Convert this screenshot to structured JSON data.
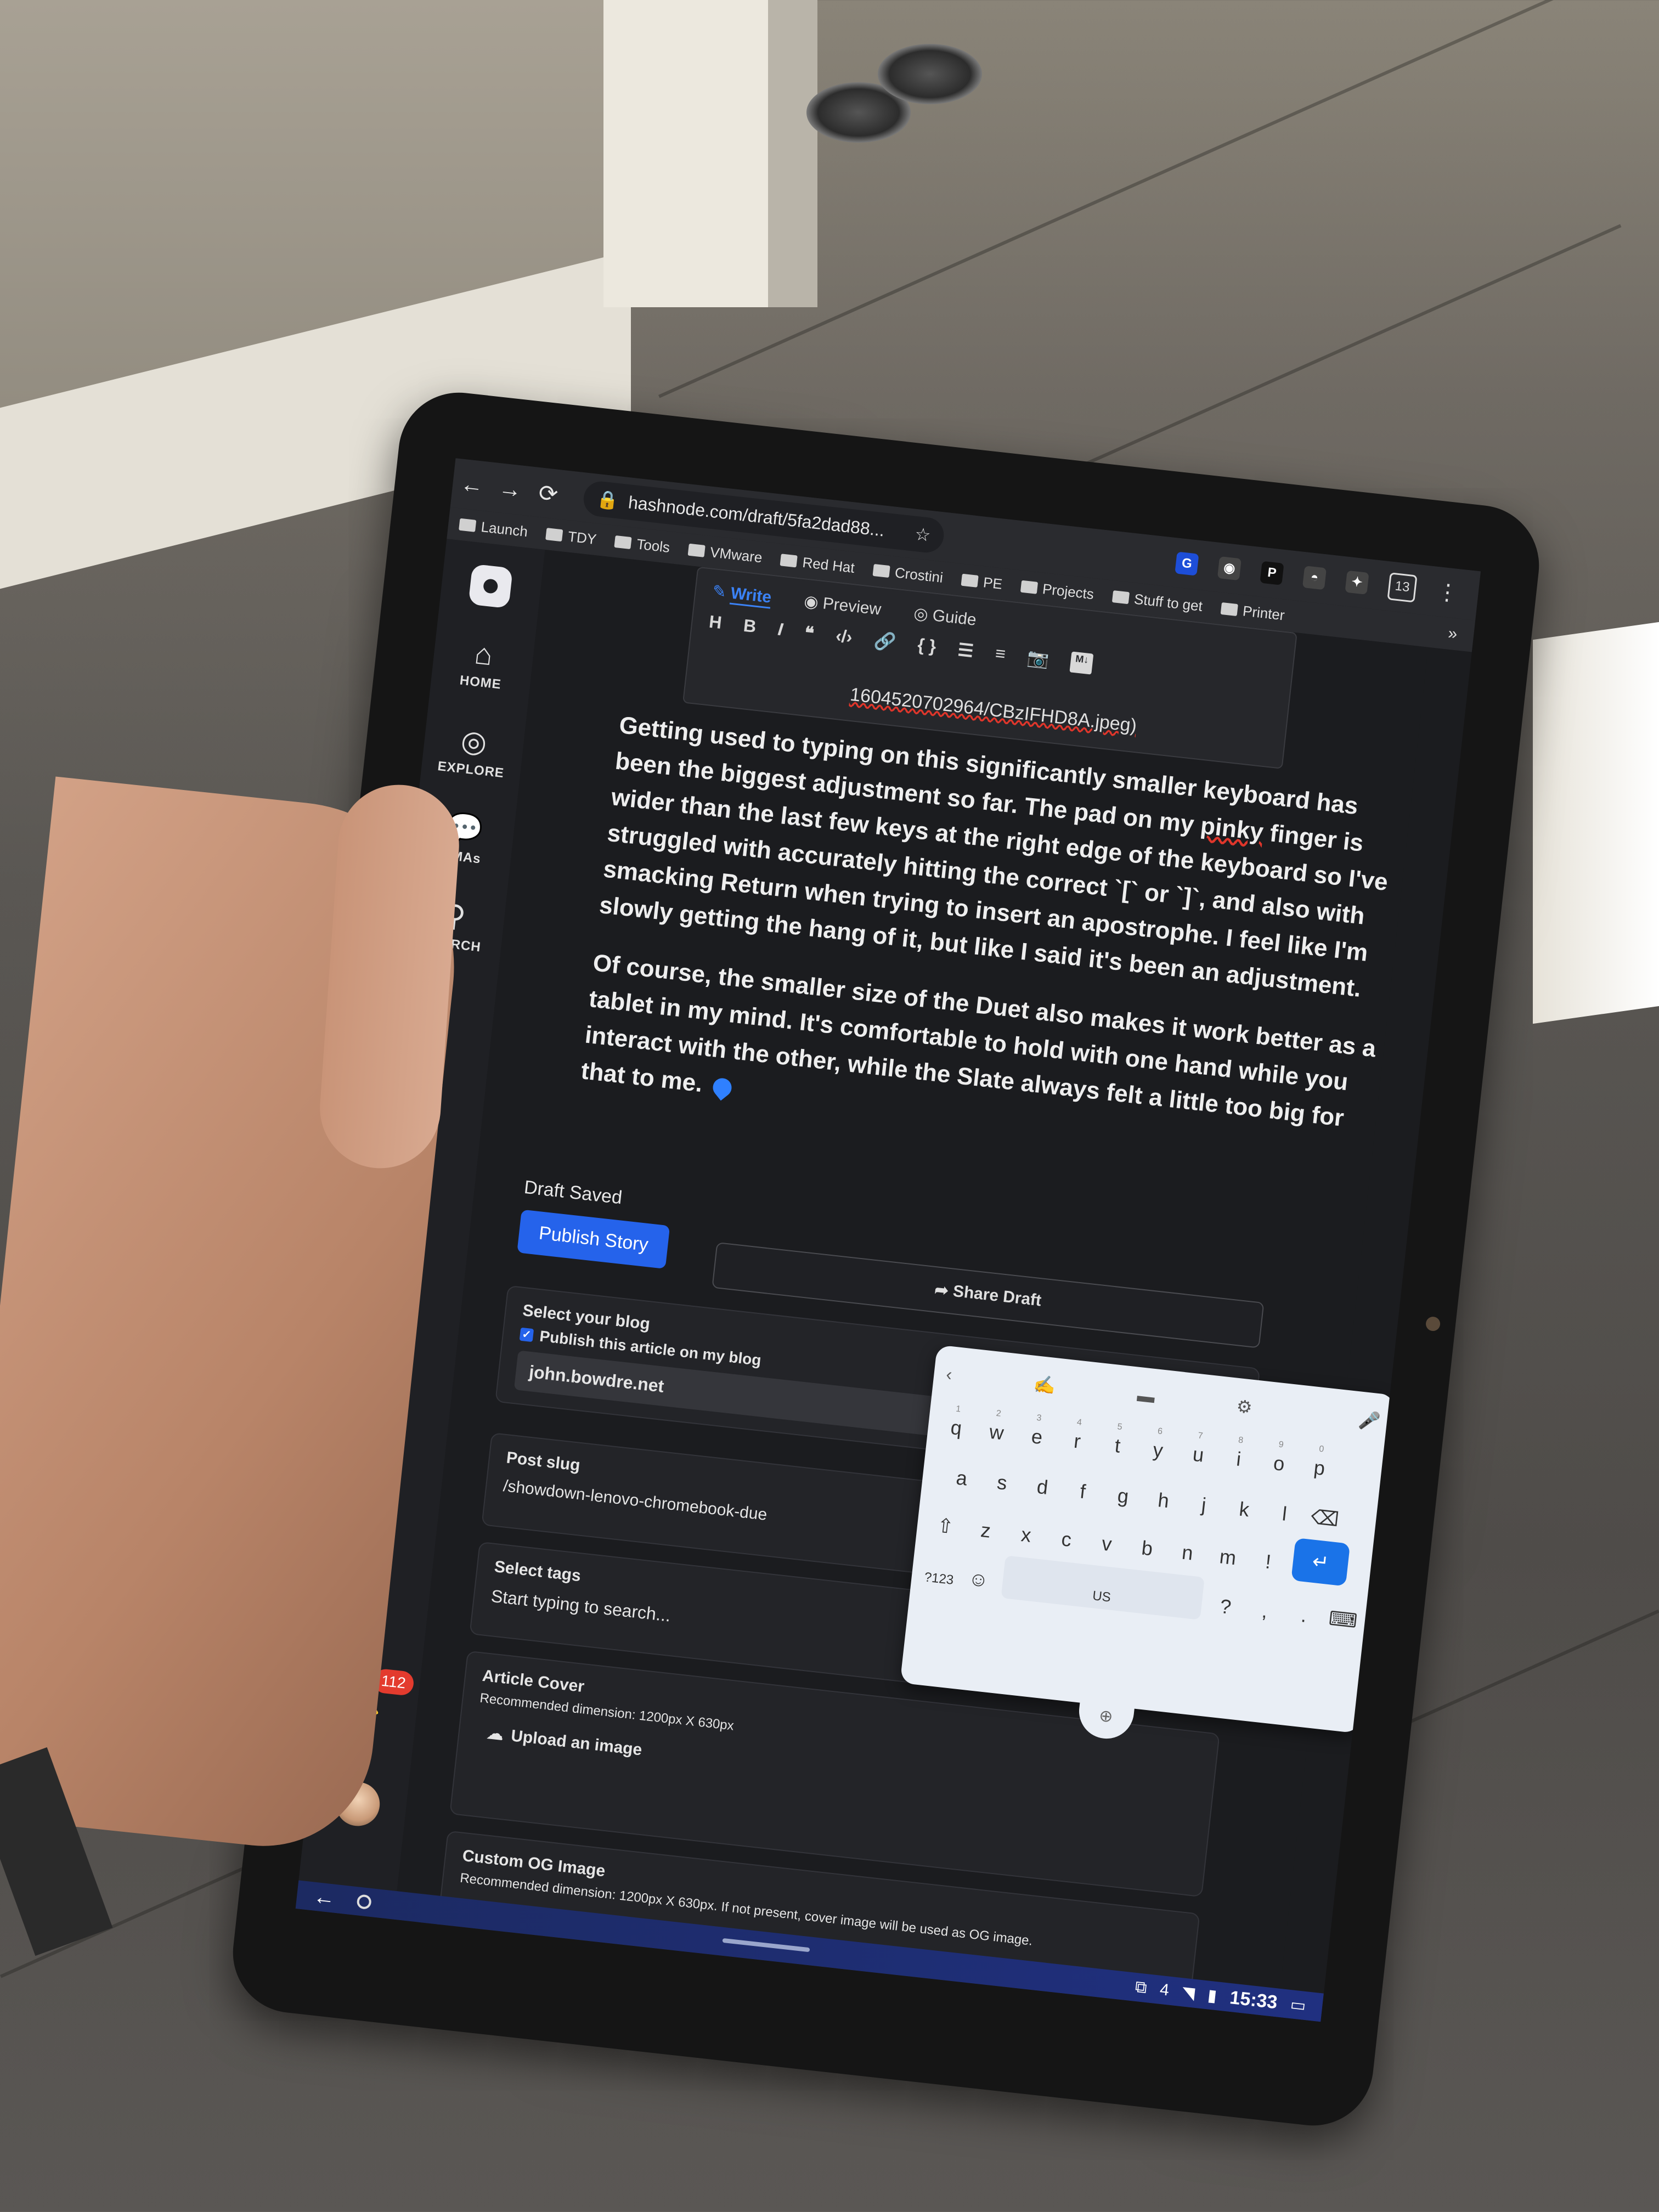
{
  "browser": {
    "url": "hashnode.com/draft/5fa2dad88...",
    "nav": {
      "back": "←",
      "forward": "→",
      "reload": "⟳"
    },
    "bookmark_star": "☆",
    "tab_count": "13",
    "menu": "⋮",
    "extensions": [
      "G",
      "◉",
      "P",
      "◓",
      "✦"
    ],
    "bookmarks": [
      "Launch",
      "TDY",
      "Tools",
      "VMware",
      "Red Hat",
      "Crostini",
      "PE",
      "Projects",
      "Stuff to get",
      "Printer"
    ],
    "bookmarks_more": "»"
  },
  "sidebar": {
    "items": [
      {
        "label": "HOME",
        "icon": "⌂"
      },
      {
        "label": "EXPLORE",
        "icon": "◎"
      },
      {
        "label": "AMAs",
        "icon": "💬"
      },
      {
        "label": "SEARCH",
        "icon": "⚲"
      }
    ],
    "theme_icon": "☀",
    "notification_icon": "🔔",
    "notification_count": "112"
  },
  "editor": {
    "tabs": {
      "write": "Write",
      "preview": "Preview",
      "guide": "Guide"
    },
    "format_buttons": [
      "H",
      "B",
      "I",
      "❝",
      "‹/›",
      "🔗",
      "{ }",
      "☰",
      "≡",
      "📷",
      "M↓"
    ],
    "url_fragment": "1604520702964/CBzIFHD8A.jpeg)",
    "paragraphs": [
      {
        "before": "Getting used to typing on this significantly smaller keyboard has been the biggest adjustment so far. The pad on my ",
        "spell": "pinky",
        "after": " finger is wider than the last few keys at the right edge of the keyboard so I've struggled with accurately hitting the correct `[` or `]`, and also with smacking Return when trying to insert an apostrophe. I feel like I'm slowly getting the hang of it, but like I said it's been an adjustment."
      },
      {
        "text": "Of course, the smaller size of the Duet also makes it work better as a tablet in my mind. It's comfortable to hold with one hand while you interact with the other, while the Slate always felt a little too big for that to me."
      }
    ]
  },
  "publish": {
    "status": "Draft Saved",
    "publish_label": "Publish Story",
    "share_label": "Share Draft",
    "blog": {
      "title": "Select your blog",
      "checkbox_label": "Publish this article on my blog",
      "value": "john.bowdre.net"
    },
    "slug": {
      "title": "Post slug",
      "value": "/showdown-lenovo-chromebook-due"
    },
    "tags": {
      "title": "Select tags",
      "placeholder": "Start typing to search..."
    },
    "cover": {
      "title": "Article Cover",
      "hint": "Recommended dimension: 1200px X 630px",
      "upload_label": "Upload an image"
    },
    "og": {
      "title": "Custom OG Image",
      "hint": "Recommended dimension: 1200px X 630px. If not present, cover image will be used as OG image."
    }
  },
  "keyboard": {
    "top": [
      "‹",
      "✍",
      "▬",
      "⚙",
      "🎤"
    ],
    "row1": [
      "q",
      "w",
      "e",
      "r",
      "t",
      "y",
      "u",
      "i",
      "o",
      "p"
    ],
    "row1_nums": [
      "1",
      "2",
      "3",
      "4",
      "5",
      "6",
      "7",
      "8",
      "9",
      "0"
    ],
    "row2": [
      "a",
      "s",
      "d",
      "f",
      "g",
      "h",
      "j",
      "k",
      "l"
    ],
    "row3": [
      "z",
      "x",
      "c",
      "v",
      "b",
      "n",
      "m",
      "!",
      "?"
    ],
    "shift": "⇧",
    "backspace": "⌫",
    "enter": "↵",
    "symbols": "?123",
    "emoji": "☺",
    "lang": "US",
    "comma": ",",
    "period": ".",
    "hide": "⌨",
    "move": "⊕"
  },
  "shelf": {
    "back": "←",
    "notifications": "4",
    "time": "15:33"
  }
}
